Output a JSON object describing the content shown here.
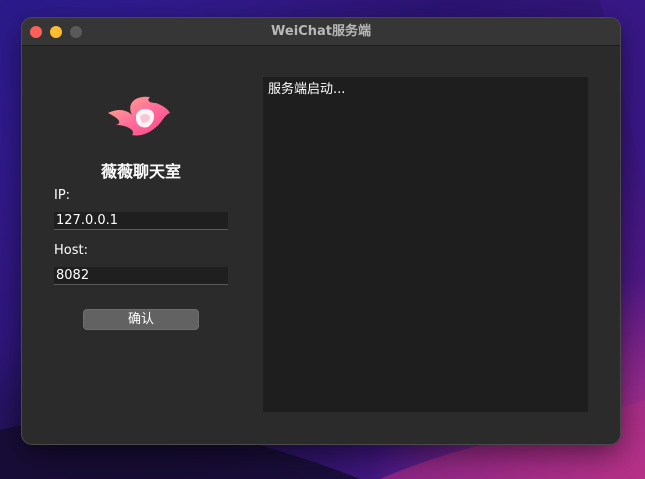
{
  "window": {
    "title": "WeiChat服务端"
  },
  "app": {
    "name": "薇薇聊天室",
    "logo": "pink-flame-logo"
  },
  "form": {
    "ip_label": "IP:",
    "ip_value": "127.0.0.1",
    "host_label": "Host:",
    "host_value": "8082",
    "confirm_label": "确认"
  },
  "log": {
    "text": "服务端启动..."
  },
  "colors": {
    "close": "#fe5f57",
    "minimize": "#febc2e",
    "maximize_disabled": "#5a5a5a",
    "window_bg": "#2b2b2b",
    "log_bg": "#1e1e1e"
  }
}
